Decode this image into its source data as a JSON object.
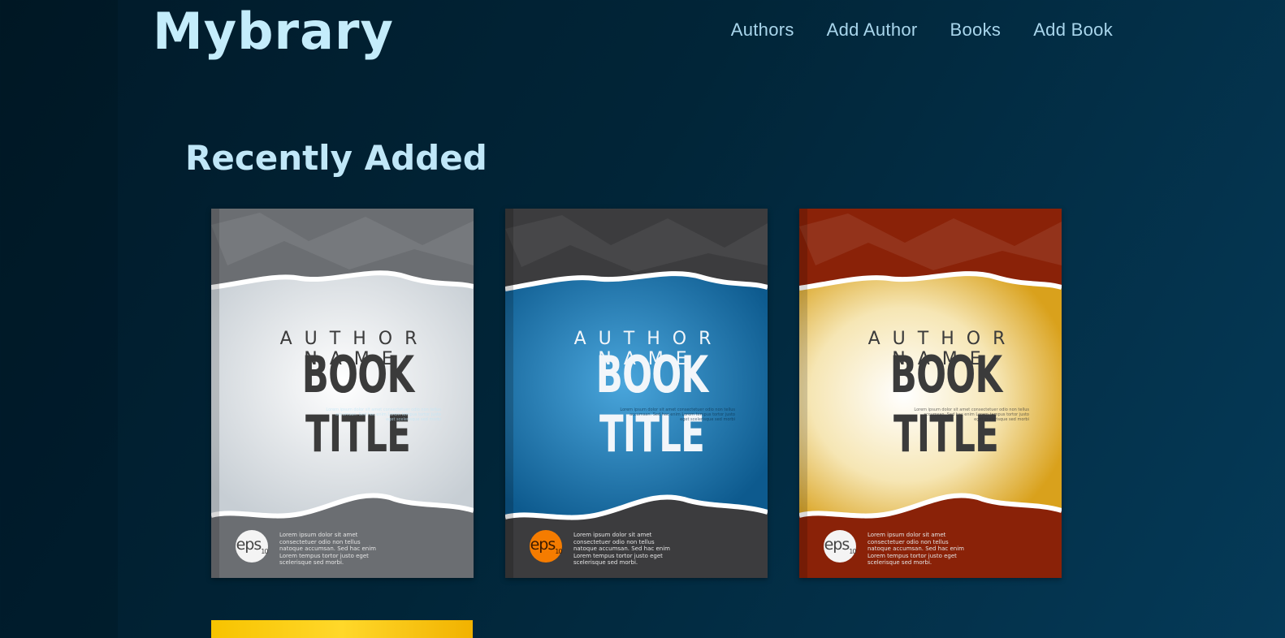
{
  "header": {
    "brand": "Mybrary",
    "nav": [
      {
        "label": "Authors"
      },
      {
        "label": "Add Author"
      },
      {
        "label": "Books"
      },
      {
        "label": "Add Book"
      }
    ]
  },
  "main": {
    "section_title": "Recently Added",
    "books": [
      {
        "author_name": "AUTHOR NAME",
        "title": "BOOK TITLE",
        "cover_color": "#e8ecef",
        "frame_color": "#6b6e72",
        "text_color": "#3b3b3b",
        "badge": "eps",
        "badge_num": "10",
        "lorem": "Lorem ipsum dolor sit amet consectetuer odio non tellus natoque accumsan. Sed hac enim Lorem tempus tortor justo eget scelerisque sed morbi."
      },
      {
        "author_name": "AUTHOR NAME",
        "title": "BOOK TITLE",
        "cover_color": "#1d76b0",
        "frame_color": "#3c3c3e",
        "text_color": "#f2f6fa",
        "badge": "eps",
        "badge_num": "10",
        "lorem": "Lorem ipsum dolor sit amet consectetuer odio non tellus natoque accumsan. Sed hac enim Lorem tempus tortor justo eget scelerisque sed morbi."
      },
      {
        "author_name": "AUTHOR NAME",
        "title": "BOOK TITLE",
        "cover_color": "#f3d680",
        "frame_color": "#8a2208",
        "text_color": "#3b3b3b",
        "badge": "eps",
        "badge_num": "10",
        "lorem": "Lorem ipsum dolor sit amet consectetuer odio non tellus natoque accumsan. Sed hac enim Lorem tempus tortor justo eget scelerisque sed morbi."
      }
    ]
  }
}
